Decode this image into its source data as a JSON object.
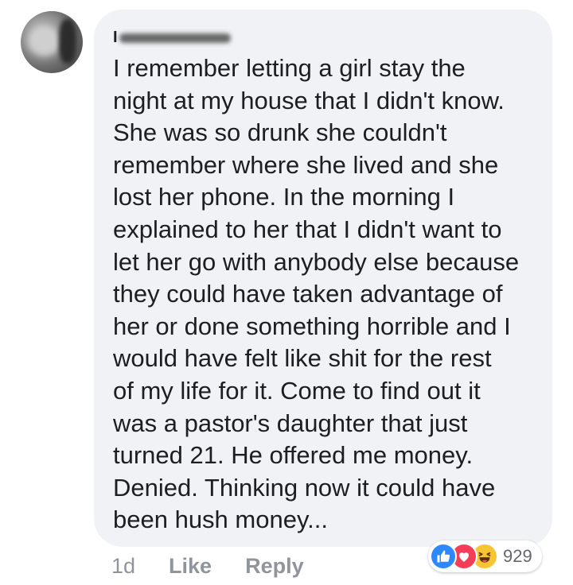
{
  "comment": {
    "author_initial": "I",
    "text": "I remember letting a girl stay the\nnight at my house that I didn't know.\nShe was so drunk she couldn't\nremember where she lived and she\nlost her phone. In the morning I\nexplained to her that I didn't want to\nlet her go with anybody else because\nthey could have taken advantage of\nher or done something horrible and I\nwould have felt like shit for the rest\nof my life for it. Come to find out it\nwas a pastor's daughter that just\nturned 21. He offered me money.\nDenied. Thinking now it could have\nbeen hush money..."
  },
  "actions": {
    "time": "1d",
    "like_label": "Like",
    "reply_label": "Reply"
  },
  "reactions": {
    "icons": [
      "like-icon",
      "love-icon",
      "haha-icon"
    ],
    "count": "929",
    "colors": {
      "like": "#2d88ff",
      "love": "#f33e58",
      "haha": "#f7c434"
    }
  },
  "colors": {
    "bubble": "#f0f2f5",
    "text": "#1c1e21",
    "muted": "#90949c"
  }
}
